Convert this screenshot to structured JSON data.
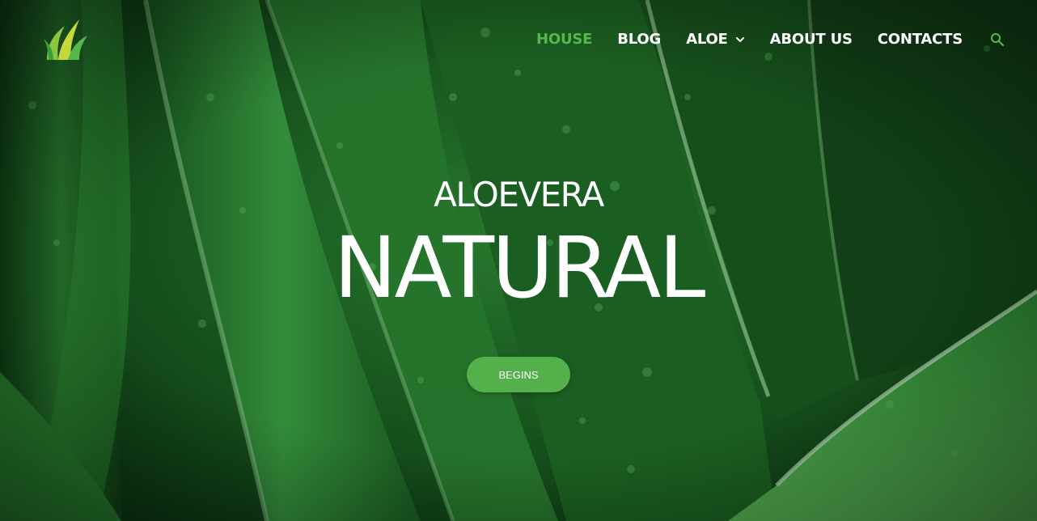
{
  "colors": {
    "accent": "#55b84c",
    "button_bg": "#53b04a",
    "text": "#ffffff"
  },
  "nav": {
    "items": [
      {
        "label": "HOUSE",
        "active": true
      },
      {
        "label": "BLOG"
      },
      {
        "label": "ALOE",
        "has_dropdown": true
      },
      {
        "label": "ABOUT US"
      },
      {
        "label": "CONTACTS"
      }
    ],
    "search_icon": "search-icon"
  },
  "logo": {
    "icon": "grass-leaf-logo"
  },
  "hero": {
    "subtitle": "ALOEVERA",
    "title": "NATURAL",
    "button_label": "BEGINS"
  }
}
